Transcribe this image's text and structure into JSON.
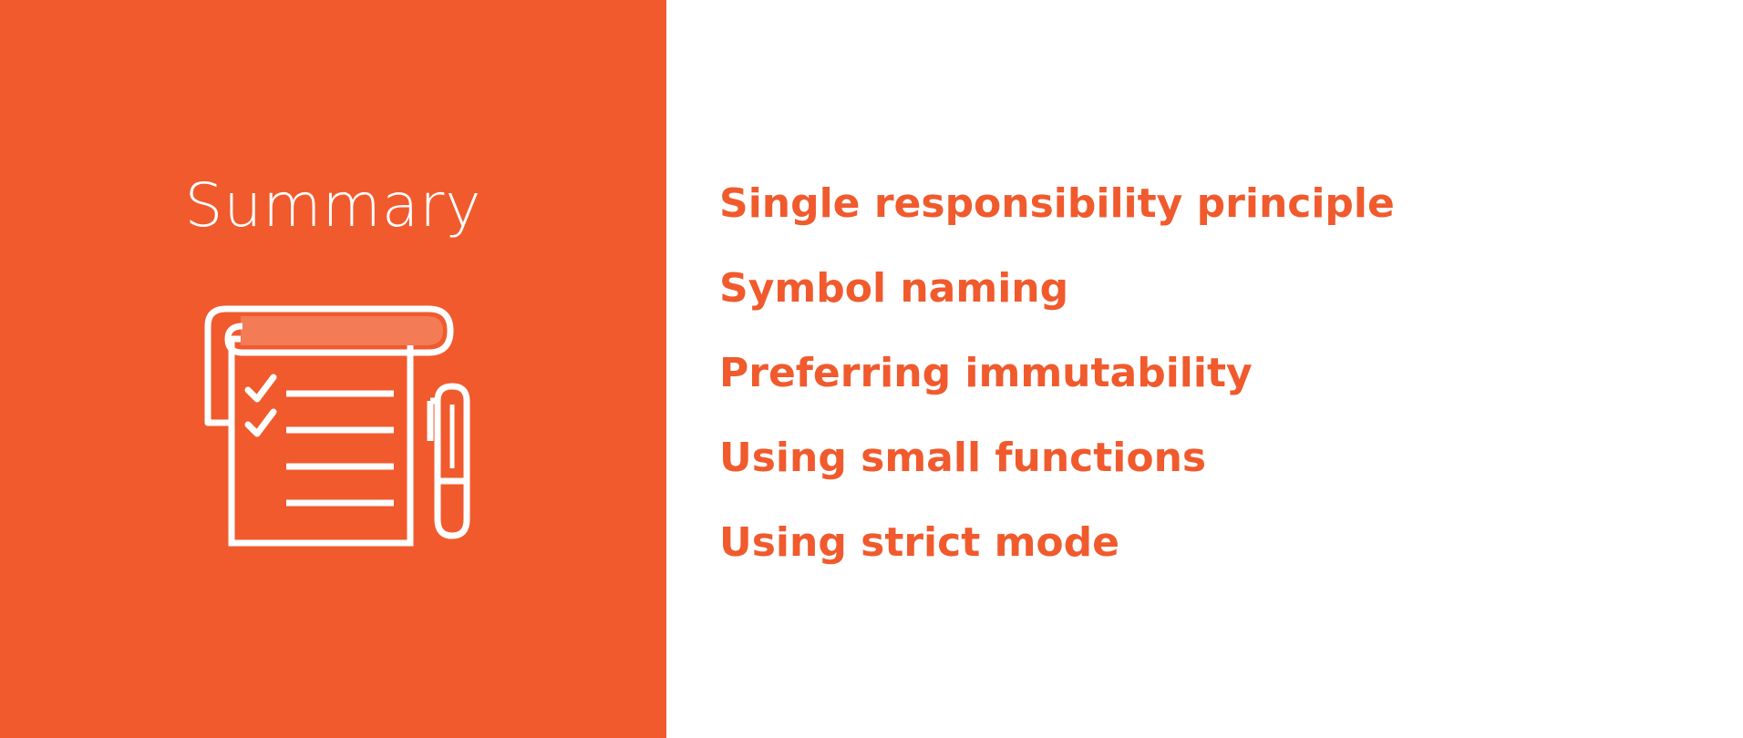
{
  "slide": {
    "title": "Summary",
    "icon": "checklist-notepad-and-pen-icon",
    "accent_color": "#f05a2d",
    "text_color": "#ffffff",
    "items": [
      "Single responsibility principle",
      "Symbol naming",
      "Preferring immutability",
      "Using small functions",
      "Using strict mode"
    ]
  }
}
